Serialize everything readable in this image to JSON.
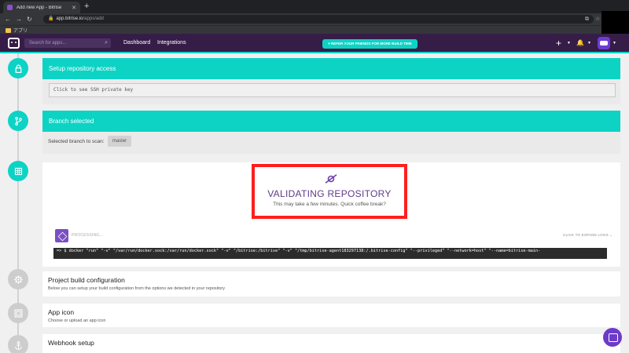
{
  "browser": {
    "tab_title": "Add new App - Bitrise",
    "url_host": "app.bitrise.io",
    "url_path": "/apps/add",
    "bookmark_label": "アプリ"
  },
  "nav": {
    "search_placeholder": "Search for apps...",
    "dashboard": "Dashboard",
    "integrations": "Integrations",
    "refer_text": "♥ REFER YOUR FRIENDS FOR MORE BUILD TIME"
  },
  "sections": {
    "repo_access_title": "Setup repository access",
    "ssh_key_text": "Click to see SSH private key",
    "branch_title": "Branch selected",
    "branch_label": "Selected branch to scan:",
    "branch_value": "master"
  },
  "validating": {
    "title": "VALIDATING REPOSITORY",
    "subtitle": "This may take a few minutes. Quick coffee break?",
    "processing": "PROCESSING...",
    "expand_logs": "CLICK TO EXPAND LOGS ⌄",
    "log_line": "=> $ docker \"run\" \"-v\" \"/var/run/docker.sock:/var/run/docker.sock\" \"-v\" \"/bitrise:/bitrise\" \"-v\" \"/tmp/bitrise-agent183297138:/.bitrise-config\" \"--privileged\" \"--network=host\" \"--name=bitrise-main-"
  },
  "build_config": {
    "title": "Project build configuration",
    "subtitle": "Below you can setup your build configuration from the options we detected in your repository"
  },
  "app_icon": {
    "title": "App icon",
    "subtitle": "Choose or upload an app icon"
  },
  "webhook": {
    "title": "Webhook setup"
  },
  "colors": {
    "accent": "#0dd3c5",
    "brand": "#351d48",
    "alert": "#ff1e1e"
  }
}
